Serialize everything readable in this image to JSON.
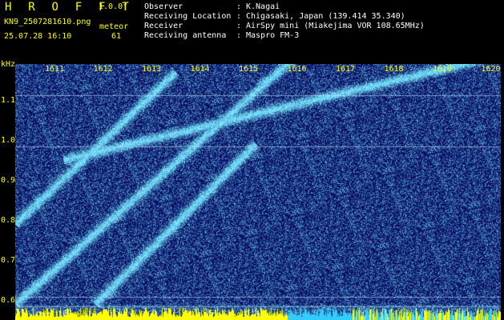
{
  "header": {
    "title": "H R O F F T",
    "version": "1.0.0f",
    "filename": "KN9_2507281610.png",
    "mode": "meteor",
    "datetime": "25.07.28 16:10",
    "count": "61",
    "info": [
      {
        "label": "Observer",
        "value": "K.Nagai"
      },
      {
        "label": "Receiving Location",
        "value": "Chigasaki, Japan (139.414 35.340)"
      },
      {
        "label": "Receiver",
        "value": "AirSpy mini (Miakejima VOR 108.65MHz)"
      },
      {
        "label": "Receiving antenna",
        "value": "Maspro FM-3"
      }
    ],
    "separator": ":"
  },
  "spectrogram": {
    "y_unit": "kHz",
    "y_ticks": [
      "1.1",
      "1.0",
      "0.9",
      "0.8",
      "0.7",
      "0.6"
    ],
    "x_ticks": [
      "1611",
      "1612",
      "1613",
      "1614",
      "1615",
      "1616",
      "1617",
      "1618",
      "1619",
      "1620"
    ],
    "colors": {
      "background": "#000066",
      "noise": "#2233cc",
      "signal": "#33ccff",
      "axis_text": "#ffff00"
    }
  }
}
